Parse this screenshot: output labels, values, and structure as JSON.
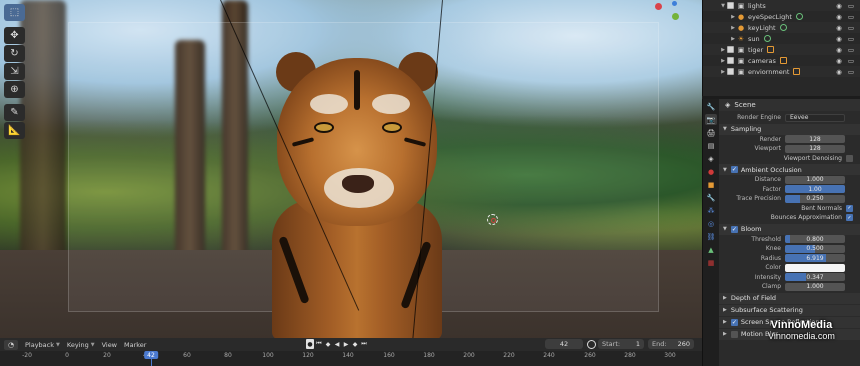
{
  "outliner": {
    "items": [
      {
        "label": "lights",
        "expanded": true,
        "icon": "collection-icon",
        "indent": 1
      },
      {
        "label": "eyeSpecLight",
        "icon": "light-icon",
        "indent": 2
      },
      {
        "label": "keyLight",
        "icon": "light-icon",
        "indent": 2
      },
      {
        "label": "sun",
        "icon": "sun-icon",
        "indent": 2
      },
      {
        "label": "tiger",
        "icon": "collection-icon",
        "indent": 1
      },
      {
        "label": "cameras",
        "icon": "collection-icon",
        "indent": 1
      },
      {
        "label": "enviornment",
        "icon": "collection-icon",
        "indent": 1
      }
    ]
  },
  "properties": {
    "scene_name": "Scene",
    "render_engine_label": "Render Engine",
    "render_engine_value": "Eevee",
    "sampling": {
      "title": "Sampling",
      "render_label": "Render",
      "render_value": "128",
      "viewport_label": "Viewport",
      "viewport_value": "128",
      "denoise_label": "Viewport Denoising"
    },
    "ambient_occlusion": {
      "title": "Ambient Occlusion",
      "distance_label": "Distance",
      "distance_value": "1.000",
      "factor_label": "Factor",
      "factor_value": "1.00",
      "trace_label": "Trace Precision",
      "trace_value": "0.250",
      "bent_label": "Bent Normals",
      "bounces_label": "Bounces Approximation"
    },
    "bloom": {
      "title": "Bloom",
      "threshold_label": "Threshold",
      "threshold_value": "0.800",
      "knee_label": "Knee",
      "knee_value": "0.500",
      "radius_label": "Radius",
      "radius_value": "6.919",
      "color_label": "Color",
      "intensity_label": "Intensity",
      "intensity_value": "0.347",
      "clamp_label": "Clamp",
      "clamp_value": "1.000"
    },
    "collapsed_sections": [
      "Depth of Field",
      "Subsurface Scattering",
      "Screen Space Reflections",
      "Motion Blur"
    ]
  },
  "timeline": {
    "menus": [
      "Playback",
      "Keying",
      "View",
      "Marker"
    ],
    "current_frame": "42",
    "start_label": "Start:",
    "start_value": "1",
    "end_label": "End:",
    "end_value": "260",
    "ruler_ticks": [
      "-20",
      "0",
      "20",
      "40",
      "60",
      "80",
      "100",
      "120",
      "140",
      "160",
      "180",
      "200",
      "220",
      "240",
      "260",
      "280",
      "300"
    ],
    "playhead": "42"
  },
  "watermark": {
    "line1": "VinnoMedia",
    "line2": "Vinnomedia.com"
  },
  "colors": {
    "accent": "#4772b3",
    "playhead": "#4b7ad0"
  }
}
